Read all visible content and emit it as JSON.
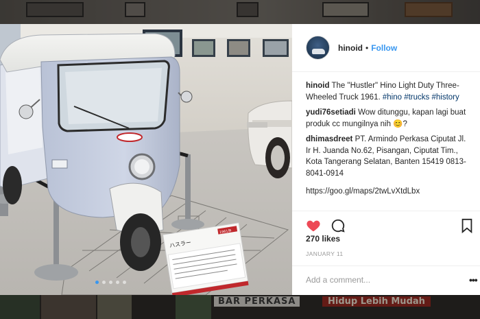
{
  "post": {
    "username": "hinoid",
    "separator": "•",
    "follow_label": "Follow",
    "caption": {
      "user": "hinoid",
      "text": "The \"Hustler\" Hino Light Duty Three-Wheeled Truck 1961.",
      "tags": [
        "#hino",
        "#trucks",
        "#history"
      ]
    },
    "comments": [
      {
        "user": "yudi76setiadi",
        "text": "Wow ditunggu, kapan lagi buat produk cc mungilnya nih 😊?"
      },
      {
        "user": "dhimasdreet",
        "text": "PT. Armindo Perkasa Ciputat Jl. Ir H. Juanda No.62, Pisangan, Ciputat Tim., Kota Tangerang Selatan, Banten 15419 0813-8041-0914"
      }
    ],
    "link": "https://goo.gl/maps/2twLvXtdLbx",
    "likes": "270 likes",
    "date": "JANUARY 11",
    "add_comment_placeholder": "Add a comment...",
    "more_label": "•••",
    "carousel": {
      "count": 5,
      "active_index": 0
    },
    "liked": true
  },
  "photo_signage": {
    "sign_title": "ハスラー",
    "sign_badge": "1961年"
  },
  "colors": {
    "accent": "#3897f0",
    "heart": "#ed4956",
    "text": "#262626",
    "muted": "#999999",
    "hashtag": "#003569"
  },
  "backdrop": {
    "banner_text_1": "BAR PERKASA",
    "banner_text_2": "Hidup Lebih Mudah"
  }
}
